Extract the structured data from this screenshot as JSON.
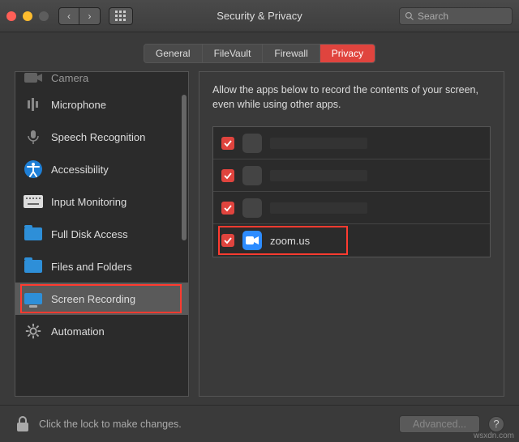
{
  "window": {
    "title": "Security & Privacy"
  },
  "search": {
    "placeholder": "Search",
    "value": ""
  },
  "tabs": [
    {
      "label": "General",
      "active": false
    },
    {
      "label": "FileVault",
      "active": false
    },
    {
      "label": "Firewall",
      "active": false
    },
    {
      "label": "Privacy",
      "active": true
    }
  ],
  "sidebar": {
    "items": [
      {
        "label": "Camera",
        "icon": "camera-icon"
      },
      {
        "label": "Microphone",
        "icon": "microphone-icon"
      },
      {
        "label": "Speech Recognition",
        "icon": "speech-icon"
      },
      {
        "label": "Accessibility",
        "icon": "accessibility-icon"
      },
      {
        "label": "Input Monitoring",
        "icon": "keyboard-icon"
      },
      {
        "label": "Full Disk Access",
        "icon": "folder-icon"
      },
      {
        "label": "Files and Folders",
        "icon": "folder-icon"
      },
      {
        "label": "Screen Recording",
        "icon": "screen-icon",
        "selected": true,
        "highlight": true
      },
      {
        "label": "Automation",
        "icon": "gear-icon"
      }
    ]
  },
  "content": {
    "description": "Allow the apps below to record the contents of your screen, even while using other apps.",
    "apps": [
      {
        "checked": true,
        "name": "",
        "redacted": true
      },
      {
        "checked": true,
        "name": "",
        "redacted": true
      },
      {
        "checked": true,
        "name": "",
        "redacted": true
      },
      {
        "checked": true,
        "name": "zoom.us",
        "icon": "zoom",
        "highlight": true
      }
    ]
  },
  "footer": {
    "lock_text": "Click the lock to make changes.",
    "advanced_label": "Advanced...",
    "help_label": "?"
  },
  "watermark": "wsxdn.com"
}
